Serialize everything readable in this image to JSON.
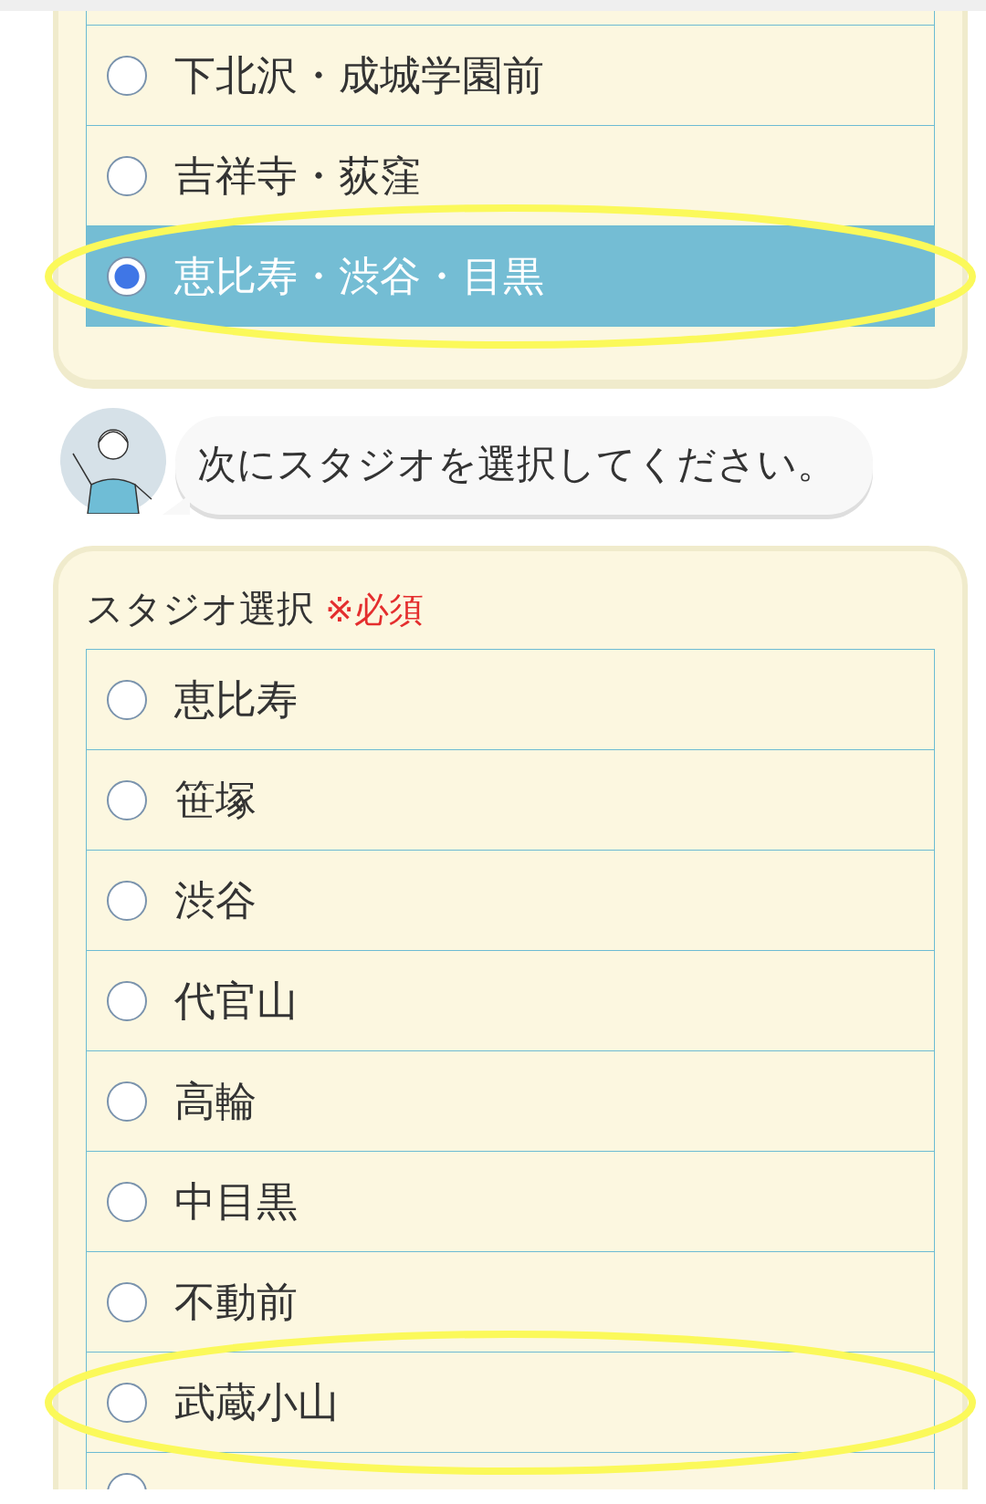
{
  "area_options": [
    {
      "label": "下北沢・成城学園前",
      "selected": false,
      "highlighted": false
    },
    {
      "label": "吉祥寺・荻窪",
      "selected": false,
      "highlighted": false
    },
    {
      "label": "恵比寿・渋谷・目黒",
      "selected": true,
      "highlighted": true
    }
  ],
  "chat": {
    "message": "次にスタジオを選択してください。"
  },
  "studio_section": {
    "title": "スタジオ選択",
    "required": "※必須",
    "options": [
      {
        "label": "恵比寿",
        "selected": false,
        "highlighted": false
      },
      {
        "label": "笹塚",
        "selected": false,
        "highlighted": false
      },
      {
        "label": "渋谷",
        "selected": false,
        "highlighted": false
      },
      {
        "label": "代官山",
        "selected": false,
        "highlighted": false
      },
      {
        "label": "高輪",
        "selected": false,
        "highlighted": false
      },
      {
        "label": "中目黒",
        "selected": false,
        "highlighted": false
      },
      {
        "label": "不動前",
        "selected": false,
        "highlighted": false
      },
      {
        "label": "武蔵小山",
        "selected": false,
        "highlighted": true
      },
      {
        "selected": false,
        "highlighted": false
      }
    ]
  }
}
